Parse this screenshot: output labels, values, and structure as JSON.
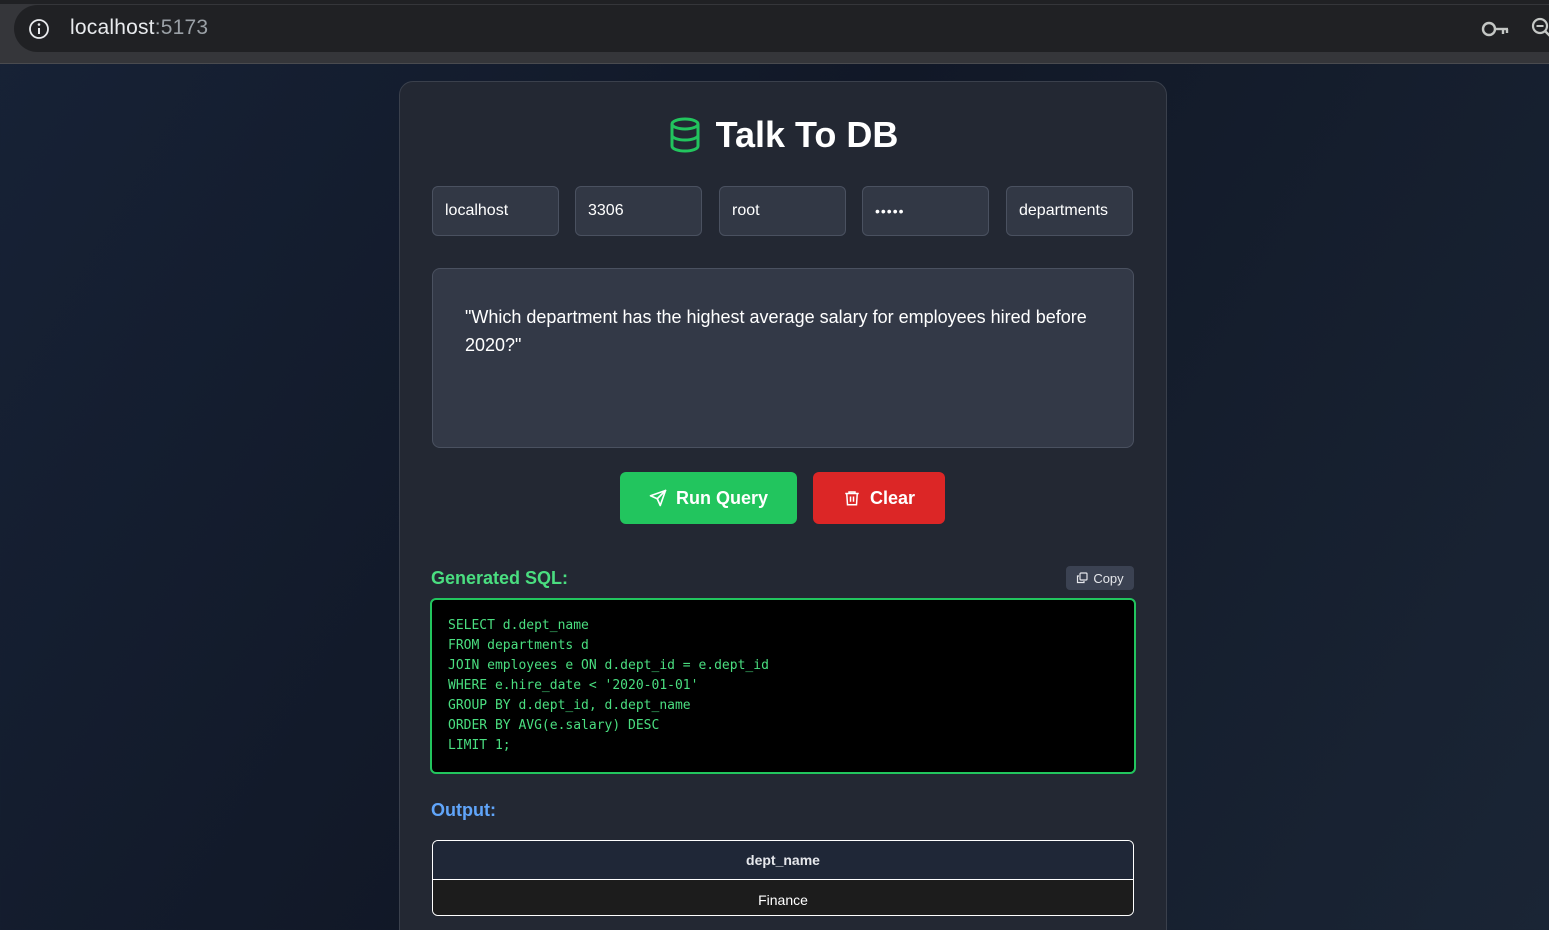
{
  "browser": {
    "url_host": "localhost",
    "url_port": ":5173"
  },
  "app": {
    "title": "Talk To DB",
    "accent_color": "#22c55e"
  },
  "connection": {
    "host": "localhost",
    "port": "3306",
    "user": "root",
    "password_masked": "•••••",
    "database": "departments"
  },
  "query": {
    "question": "\"Which department has the highest average salary for employees hired before 2020?\""
  },
  "actions": {
    "run_label": "Run Query",
    "clear_label": "Clear",
    "run_color": "#22c55e",
    "clear_color": "#dc2626"
  },
  "sql": {
    "label": "Generated SQL:",
    "copy_label": "Copy",
    "lines": [
      "SELECT d.dept_name",
      "FROM departments d",
      "JOIN employees e ON d.dept_id = e.dept_id",
      "WHERE e.hire_date < '2020-01-01'",
      "GROUP BY d.dept_id, d.dept_name",
      "ORDER BY AVG(e.salary) DESC",
      "LIMIT 1;"
    ]
  },
  "output": {
    "label": "Output:",
    "columns": [
      "dept_name"
    ],
    "rows": [
      [
        "Finance"
      ]
    ]
  },
  "icons": {
    "info": "info-icon",
    "key": "key-icon",
    "zoom": "zoom-icon",
    "database": "database-icon",
    "send": "send-icon",
    "trash": "trash-icon",
    "copy": "copy-icon"
  }
}
